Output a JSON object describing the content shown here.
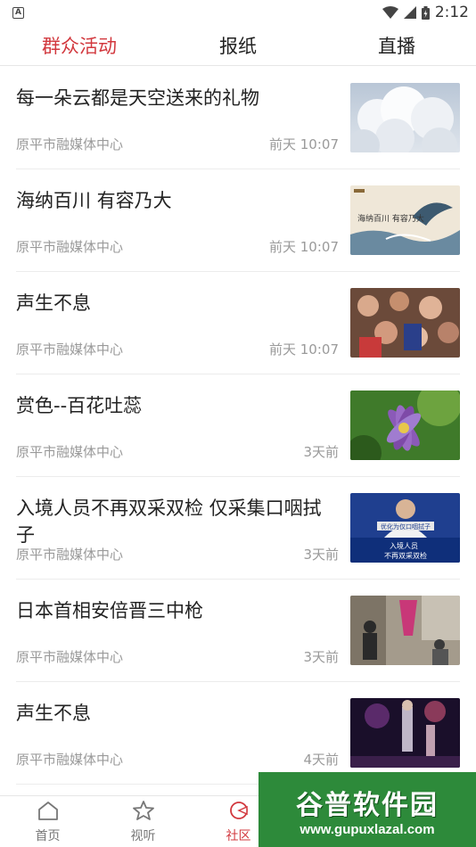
{
  "status_bar": {
    "time": "2:12",
    "app_badge": "A"
  },
  "tabs": [
    {
      "label": "群众活动",
      "active": true
    },
    {
      "label": "报纸",
      "active": false
    },
    {
      "label": "直播",
      "active": false
    }
  ],
  "articles": [
    {
      "title": "每一朵云都是天空送来的礼物",
      "source": "原平市融媒体中心",
      "time": "前天 10:07",
      "thumb": "clouds"
    },
    {
      "title": "海纳百川  有容乃大",
      "source": "原平市融媒体中心",
      "time": "前天 10:07",
      "thumb": "painting",
      "thumb_text": "海纳百川 有容乃大"
    },
    {
      "title": "声生不息",
      "source": "原平市融媒体中心",
      "time": "前天 10:07",
      "thumb": "crowd"
    },
    {
      "title": "赏色--百花吐蕊",
      "source": "原平市融媒体中心",
      "time": "3天前",
      "thumb": "flower"
    },
    {
      "title": "入境人员不再双采双检  仅采集口咽拭子",
      "source": "原平市融媒体中心",
      "time": "3天前",
      "thumb": "news",
      "thumb_text": [
        "优化为仅口咽拭子",
        "入境人员",
        "不再双采双检"
      ]
    },
    {
      "title": "日本首相安倍晋三中枪",
      "source": "原平市融媒体中心",
      "time": "3天前",
      "thumb": "street"
    },
    {
      "title": "声生不息",
      "source": "原平市融媒体中心",
      "time": "4天前",
      "thumb": "stage"
    }
  ],
  "bottom_nav": [
    {
      "label": "首页",
      "icon": "home-icon",
      "active": false
    },
    {
      "label": "视听",
      "icon": "star-icon",
      "active": false
    },
    {
      "label": "社区",
      "icon": "community-icon",
      "active": true
    }
  ],
  "watermark": {
    "title": "谷普软件园",
    "url": "www.gupuxlazal.com"
  },
  "colors": {
    "accent": "#d2383e",
    "watermark": "#2d8a3a"
  }
}
